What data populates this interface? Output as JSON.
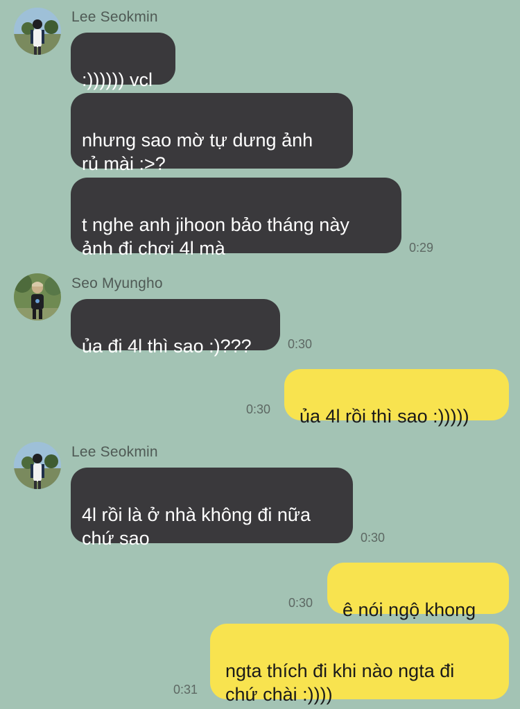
{
  "chat": {
    "messages": [
      {
        "sender": "Lee Seokmin",
        "text": ":)))))) vcl",
        "time": ""
      },
      {
        "sender": "Lee Seokmin",
        "text": "nhưng sao mờ tự dưng ảnh\nrủ mài :>?",
        "time": ""
      },
      {
        "sender": "Lee Seokmin",
        "text": "t nghe anh jihoon bảo tháng này\nảnh đi chơi 4l mà",
        "time": "0:29"
      },
      {
        "sender": "Seo Myungho",
        "text": "ủa đi 4l thì sao :)???",
        "time": "0:30"
      },
      {
        "sender": "me",
        "text": "ủa 4l rồi thì sao :)))))",
        "time": "0:30"
      },
      {
        "sender": "Lee Seokmin",
        "text": "4l rồi là ở nhà không đi nữa\nchứ sao",
        "time": "0:30"
      },
      {
        "sender": "me",
        "text": "ê nói ngộ khong",
        "time": "0:30"
      },
      {
        "sender": "me",
        "text": "ngta thích đi khi nào ngta đi\nchứ chài :))))",
        "time": "0:31"
      }
    ]
  },
  "colors": {
    "background": "#a3c3b4",
    "incoming_bubble": "#3a393c",
    "outgoing_bubble": "#f8e34f"
  }
}
